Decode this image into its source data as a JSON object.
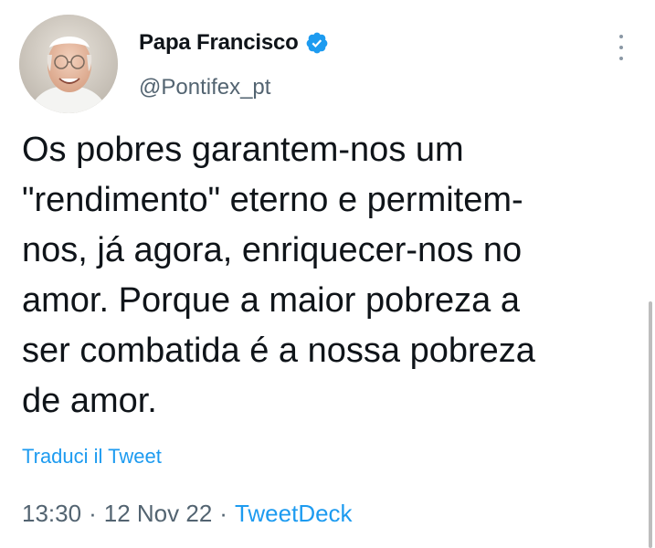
{
  "author": {
    "display_name": "Papa Francisco",
    "handle": "@Pontifex_pt",
    "verified": true,
    "avatar_icon": "person-photo-avatar"
  },
  "tweet": {
    "lines": [
      "Os pobres garantem-nos um",
      "\"rendimento\" eterno e permitem-",
      "nos, já agora, enriquecer-nos no",
      "amor. Porque a maior pobreza a",
      "ser combatida é a nossa pobreza",
      "de amor."
    ],
    "translate_label": "Traduci il Tweet"
  },
  "meta": {
    "time": "13:30",
    "separator": "·",
    "date": "12 Nov 22",
    "source": "TweetDeck"
  },
  "colors": {
    "accent": "#1d9bf0",
    "text": "#0f1419",
    "secondary": "#536471"
  }
}
